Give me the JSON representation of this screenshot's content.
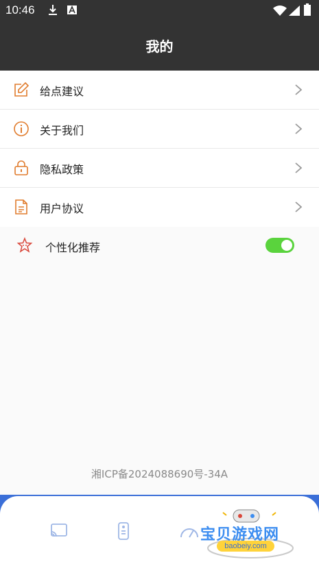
{
  "status_bar": {
    "time": "10:46",
    "icons": [
      "download-icon",
      "a-notification-icon",
      "wifi-icon",
      "signal-icon",
      "battery-icon"
    ]
  },
  "header": {
    "title": "我的"
  },
  "menu": [
    {
      "label": "给点建议",
      "icon": "edit-icon"
    },
    {
      "label": "关于我们",
      "icon": "info-icon"
    },
    {
      "label": "隐私政策",
      "icon": "lock-icon"
    },
    {
      "label": "用户协议",
      "icon": "document-icon"
    }
  ],
  "personalization": {
    "label": "个性化推荐",
    "enabled": true
  },
  "icp": "湘ICP备2024088690号-34A",
  "bottom_nav": [
    "cast-icon",
    "remote-icon",
    "speedometer-icon"
  ],
  "watermark": {
    "title": "宝贝游戏网",
    "url": "baobeiy.com"
  },
  "colors": {
    "header": "#333333",
    "accent": "#e07b2c",
    "toggle_on": "#5ad33d",
    "nav": "#3b6fd8"
  }
}
